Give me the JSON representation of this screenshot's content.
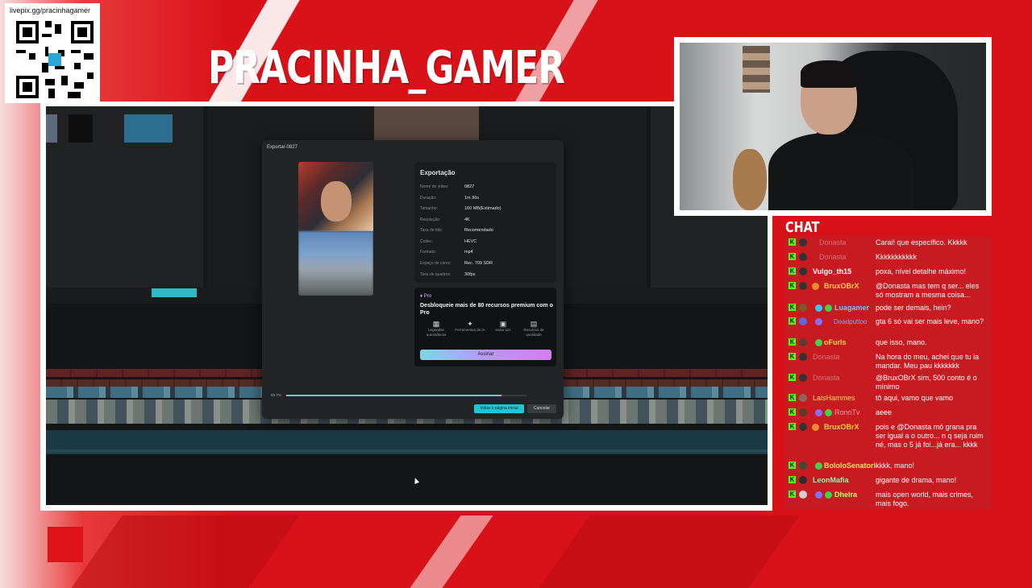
{
  "overlay": {
    "qr_url": "livepix.gg/pracinhagamer",
    "channel_title": "PRACINHA_GAMER",
    "chat_heading": "CHAT"
  },
  "export_dialog": {
    "title": "Exportar-0827",
    "section_title": "Exportação",
    "fields": [
      {
        "label": "Nome do vídeo:",
        "value": "0827"
      },
      {
        "label": "Duração:",
        "value": "1m 36s"
      },
      {
        "label": "Tamanho:",
        "value": "160 MB(Estimado)"
      },
      {
        "label": "Resolução:",
        "value": "4K"
      },
      {
        "label": "Taxa de bits:",
        "value": "Recomendado"
      },
      {
        "label": "Codec:",
        "value": "HEVC"
      },
      {
        "label": "Formato:",
        "value": "mp4"
      },
      {
        "label": "Espaço de cores:",
        "value": "Rec. 709 SDR"
      },
      {
        "label": "Taxa de quadros:",
        "value": "30fps"
      }
    ],
    "pro": {
      "badge": "Pro",
      "headline": "Desbloqueie mais de 80 recursos premium com o Pro",
      "features": [
        {
          "icon": "captions-icon",
          "label": "Legendas automáticas"
        },
        {
          "icon": "ai-tools-icon",
          "label": "Ferramentas de IA"
        },
        {
          "icon": "isolate-voice-icon",
          "label": "Isolar voz"
        },
        {
          "icon": "quality-icon",
          "label": "Recursos de qualidade"
        }
      ],
      "subscribe_label": "Assinar"
    },
    "progress": {
      "label": "89.7%",
      "fraction": 0.897
    },
    "home_button": "Voltar à página inicial",
    "cancel_button": "Cancelar"
  },
  "chat": {
    "messages": [
      {
        "user": "Donasta",
        "user_color": "#d9717a",
        "text": "Carai! que específico. Kkkkk"
      },
      {
        "user": "Donasta",
        "user_color": "#d9717a",
        "text": "Kkkkkkkkkkk"
      },
      {
        "user": "Vulgo_th15",
        "user_color": "#ffffff",
        "text": "poxa, nível detalhe máximo!"
      },
      {
        "user": "BruxOBrX",
        "user_color": "#ffcf3f",
        "text": "@Donasta mas tem q ser... eles só mostram a mesma coisa..."
      },
      {
        "user": "Luagamer",
        "user_color": "#5ed1ff",
        "text": "pode ser demais, hein?"
      },
      {
        "user": "Deadputtoo",
        "user_color": "#6ab0ff",
        "text": "gta 6 só vai ser mais leve, mano?"
      },
      {
        "user": "oFurls",
        "user_color": "#ffd447",
        "text": "que isso, mano."
      },
      {
        "user": "Donasta",
        "user_color": "#d9717a",
        "text": "Na hora do meu, achei que tu ia mandar. Meu pau kkkkkkk"
      },
      {
        "user": "Donasta",
        "user_color": "#d9717a",
        "text": "@BruxOBrX sim, 500 conto é o mínimo"
      },
      {
        "user": "LaisHammes",
        "user_color": "#ffd95a",
        "text": "tô aqui, vamo que vamo"
      },
      {
        "user": "RonnTv",
        "user_color": "#ff9a9a",
        "text": "aeee"
      },
      {
        "user": "BruxOBrX",
        "user_color": "#ffcf3f",
        "text": "pois e @Donasta mó grana pra ser igual a o outro... n q seja ruim né, mas o 5 já foi...já era... kkkk"
      },
      {
        "user": "BololoSenatori",
        "user_color": "#ffe066",
        "text": "kkkk, mano!"
      },
      {
        "user": "LeonMafia",
        "user_color": "#7dffb0",
        "text": "gigante de drama, mano!"
      },
      {
        "user": "Dhelra",
        "user_color": "#c9ff5a",
        "text": "mais open world, mais crimes, mais fogo."
      }
    ]
  }
}
